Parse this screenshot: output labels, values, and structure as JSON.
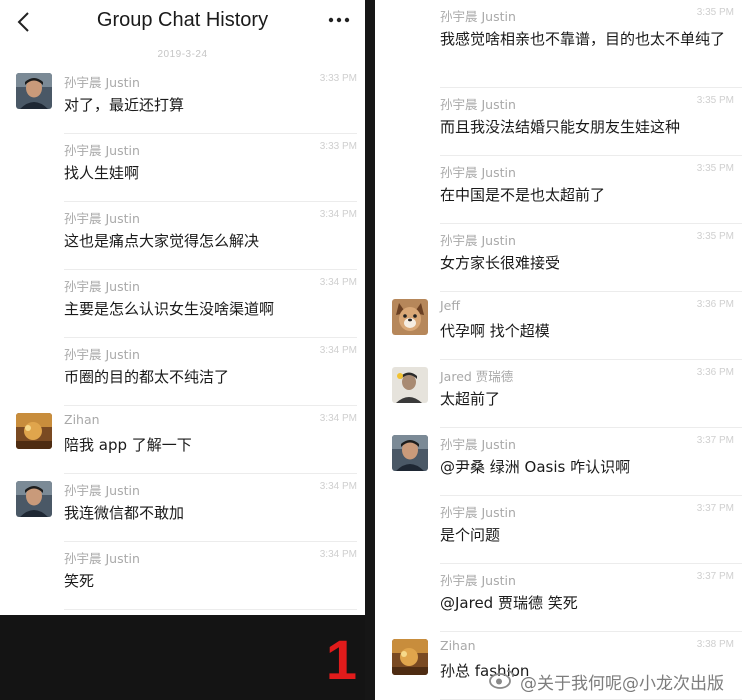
{
  "header": {
    "title": "Group Chat History",
    "date": "2019-3-24"
  },
  "page_number": "1",
  "left_messages": [
    {
      "sender": "孙宇晨 Justin",
      "time": "3:33 PM",
      "text": "对了，最近还打算",
      "avatar": "justin"
    },
    {
      "sender": "孙宇晨 Justin",
      "time": "3:33 PM",
      "text": "找人生娃啊"
    },
    {
      "sender": "孙宇晨 Justin",
      "time": "3:34 PM",
      "text": "这也是痛点大家觉得怎么解决"
    },
    {
      "sender": "孙宇晨 Justin",
      "time": "3:34 PM",
      "text": "主要是怎么认识女生没啥渠道啊"
    },
    {
      "sender": "孙宇晨 Justin",
      "time": "3:34 PM",
      "text": "币圈的目的都太不纯洁了"
    },
    {
      "sender": "Zihan",
      "time": "3:34 PM",
      "text": "陪我 app 了解一下",
      "avatar": "zihan"
    },
    {
      "sender": "孙宇晨 Justin",
      "time": "3:34 PM",
      "text": "我连微信都不敢加",
      "avatar": "justin"
    },
    {
      "sender": "孙宇晨 Justin",
      "time": "3:34 PM",
      "text": "笑死"
    }
  ],
  "right_messages": [
    {
      "sender": "孙宇晨 Justin",
      "time": "3:35 PM",
      "text": "我感觉啥相亲也不靠谱，目的也太不单纯了",
      "two_lines": true
    },
    {
      "sender": "孙宇晨 Justin",
      "time": "3:35 PM",
      "text": "而且我没法结婚只能女朋友生娃这种"
    },
    {
      "sender": "孙宇晨 Justin",
      "time": "3:35 PM",
      "text": "在中国是不是也太超前了"
    },
    {
      "sender": "孙宇晨 Justin",
      "time": "3:35 PM",
      "text": "女方家长很难接受"
    },
    {
      "sender": "Jeff",
      "time": "3:36 PM",
      "text": "代孕啊 找个超模",
      "avatar": "jeff"
    },
    {
      "sender": "Jared 贾瑞德",
      "time": "3:36 PM",
      "text": "太超前了",
      "avatar": "jared"
    },
    {
      "sender": "孙宇晨 Justin",
      "time": "3:37 PM",
      "text": "@尹桑 绿洲 Oasis 咋认识啊",
      "avatar": "justin"
    },
    {
      "sender": "孙宇晨 Justin",
      "time": "3:37 PM",
      "text": "是个问题"
    },
    {
      "sender": "孙宇晨 Justin",
      "time": "3:37 PM",
      "text": "@Jared 贾瑞德 笑死"
    },
    {
      "sender": "Zihan",
      "time": "3:38 PM",
      "text": "孙总 fashion",
      "avatar": "zihan"
    }
  ],
  "watermark": "@关于我何呢@小龙次出版",
  "colors": {
    "panel_bg": "#ffffff",
    "page_bg": "#141414",
    "page_number": "#e01b1b",
    "sender": "#a9a9a9",
    "time": "#cfcfcf"
  }
}
